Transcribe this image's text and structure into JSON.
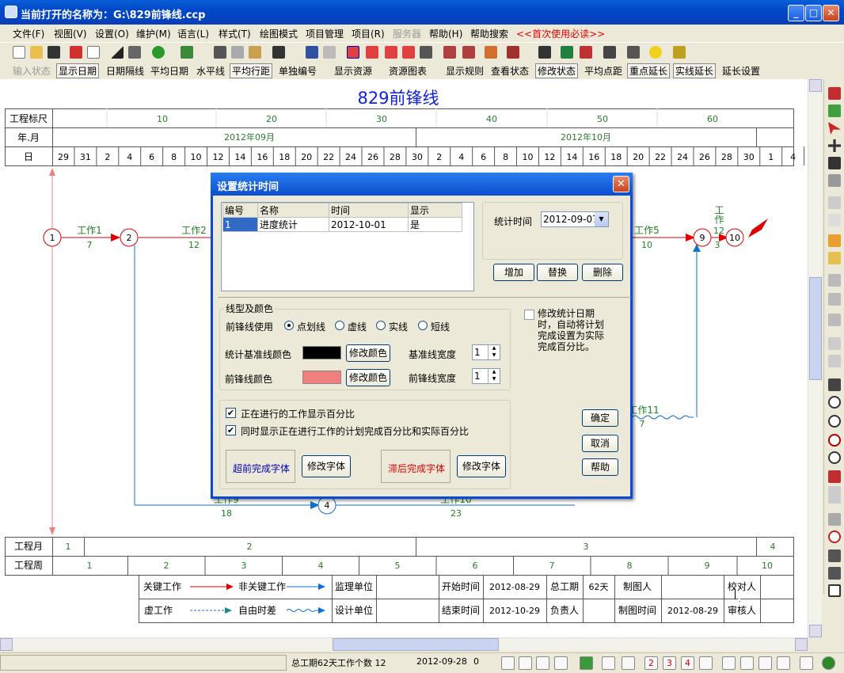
{
  "window": {
    "title": "当前打开的名称为：G:\\829前锋线.ccp"
  },
  "menu": [
    "文件(F)",
    "视图(V)",
    "设置(O)",
    "维护(M)",
    "语言(L)",
    "样式(T)",
    "绘图模式",
    "项目管理",
    "项目(R)",
    "服务器",
    "帮助(H)",
    "帮助搜索",
    "<<首次使用必读>>"
  ],
  "toolbar2": [
    "输入状态",
    "显示日期",
    "日期隔线",
    "平均日期",
    "水平线",
    "平均行距",
    "单独编号",
    "显示资源",
    "资源图表",
    "显示规则",
    "查看状态",
    "修改状态",
    "平均点距",
    "重点延长",
    "实线延长",
    "延长设置"
  ],
  "chart": {
    "title": "829前锋线",
    "scale_label": "工程标尺",
    "ym_label": "年.月",
    "day_label": "日",
    "scale_ticks": [
      "10",
      "20",
      "30",
      "40",
      "50",
      "60"
    ],
    "months": [
      "2012年09月",
      "2012年10月"
    ],
    "days": [
      "29",
      "31",
      "2",
      "4",
      "6",
      "8",
      "10",
      "12",
      "14",
      "16",
      "18",
      "20",
      "22",
      "24",
      "26",
      "28",
      "30",
      "2",
      "4",
      "6",
      "8",
      "10",
      "12",
      "14",
      "16",
      "18",
      "20",
      "22",
      "24",
      "26",
      "28",
      "30",
      "1",
      "4"
    ],
    "nodes": [
      "1",
      "2",
      "4",
      "9",
      "10"
    ],
    "works": [
      {
        "name": "工作1",
        "dur": "7"
      },
      {
        "name": "工作2",
        "dur": "12"
      },
      {
        "name": "工作5",
        "dur": "10"
      },
      {
        "name": "工作",
        "dur": "12"
      },
      {
        "name": "工作11",
        "dur": "7"
      },
      {
        "name": "工作9",
        "dur": "18"
      },
      {
        "name": "工作10",
        "dur": "23"
      }
    ],
    "extra_dur": "3",
    "month_row_label": "工程月",
    "months_num": [
      "1",
      "2",
      "3",
      "4"
    ],
    "week_row_label": "工程周",
    "weeks_num": [
      "1",
      "2",
      "3",
      "4",
      "5",
      "6",
      "7",
      "8",
      "9",
      "10"
    ]
  },
  "legend": {
    "critical": "关键工作",
    "noncritical": "非关键工作",
    "virtual": "虚工作",
    "free": "自由时差",
    "supervisor": "监理单位",
    "designer": "设计单位",
    "start_label": "开始时间",
    "start": "2012-08-29",
    "duration_label": "总工期",
    "duration": "62天",
    "drawer": "制图人",
    "checker": "校对人",
    "end_label": "结束时间",
    "end": "2012-10-29",
    "owner": "负责人",
    "draw_time_label": "制图时间",
    "draw_time": "2012-08-29",
    "reviewer": "审核人"
  },
  "dialog": {
    "title": "设置统计时间",
    "headers": [
      "编号",
      "名称",
      "时间",
      "显示"
    ],
    "rows": [
      [
        "1",
        "进度统计",
        "2012-10-01",
        "是"
      ]
    ],
    "stat_time_label": "统计时间",
    "stat_time_value": "2012-09-07",
    "add": "增加",
    "replace": "替换",
    "delete": "删除",
    "line_group": "线型及颜色",
    "front_use": "前锋线使用",
    "line_types": [
      "点划线",
      "虚线",
      "实线",
      "短线"
    ],
    "base_color_label": "统计基准线颜色",
    "modify_color": "修改颜色",
    "base_width_label": "基准线宽度",
    "base_width": "1",
    "front_color_label": "前锋线颜色",
    "front_width_label": "前锋线宽度",
    "front_width": "1",
    "modify_note": "修改统计日期时，自动将计划完成设置为实际完成百分比。",
    "ok": "确定",
    "cancel": "取消",
    "help": "帮助",
    "chk1": "正在进行的工作显示百分比",
    "chk2": "同时显示正在进行工作的计划完成百分比和实际百分比",
    "ahead_font": "超前完成字体",
    "modify_font": "修改字体",
    "behind_font": "滞后完成字体",
    "colors": {
      "base": "#000000",
      "front": "#f08080",
      "ahead": "#0000c0",
      "behind": "#e00000"
    }
  },
  "status": {
    "summary": "总工期62天工作个数 12",
    "date": "2012-09-28",
    "val": "0"
  }
}
